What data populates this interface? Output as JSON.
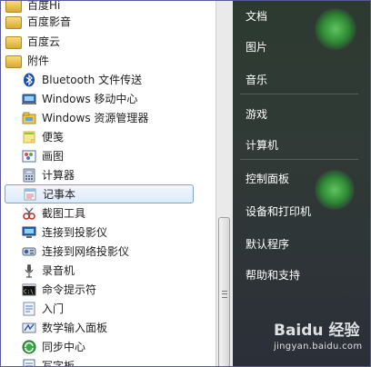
{
  "programs": {
    "items": [
      {
        "label": "百度Hi",
        "type": "folder",
        "icon": "folder-icon"
      },
      {
        "label": "百度影音",
        "type": "folder",
        "icon": "folder-icon"
      },
      {
        "label": "百度云",
        "type": "folder",
        "icon": "folder-icon"
      },
      {
        "label": "附件",
        "type": "folder",
        "icon": "folder-icon"
      },
      {
        "label": "Bluetooth 文件传送",
        "type": "item",
        "icon": "bluetooth-icon"
      },
      {
        "label": "Windows 移动中心",
        "type": "item",
        "icon": "mobility-center-icon"
      },
      {
        "label": "Windows 资源管理器",
        "type": "item",
        "icon": "explorer-icon"
      },
      {
        "label": "便笺",
        "type": "item",
        "icon": "sticky-notes-icon"
      },
      {
        "label": "画图",
        "type": "item",
        "icon": "paint-icon"
      },
      {
        "label": "计算器",
        "type": "item",
        "icon": "calculator-icon"
      },
      {
        "label": "记事本",
        "type": "item",
        "icon": "notepad-icon",
        "selected": true
      },
      {
        "label": "截图工具",
        "type": "item",
        "icon": "snipping-tool-icon"
      },
      {
        "label": "连接到投影仪",
        "type": "item",
        "icon": "projector-icon"
      },
      {
        "label": "连接到网络投影仪",
        "type": "item",
        "icon": "network-projector-icon"
      },
      {
        "label": "录音机",
        "type": "item",
        "icon": "microphone-icon"
      },
      {
        "label": "命令提示符",
        "type": "item",
        "icon": "cmd-icon"
      },
      {
        "label": "入门",
        "type": "item",
        "icon": "getting-started-icon"
      },
      {
        "label": "数学输入面板",
        "type": "item",
        "icon": "math-input-icon"
      },
      {
        "label": "同步中心",
        "type": "item",
        "icon": "sync-center-icon"
      },
      {
        "label": "写字板",
        "type": "item",
        "icon": "wordpad-icon"
      }
    ]
  },
  "right_menu": {
    "items": [
      "文档",
      "图片",
      "音乐",
      "游戏",
      "计算机",
      "控制面板",
      "设备和打印机",
      "默认程序",
      "帮助和支持"
    ]
  },
  "watermark": {
    "title": "Baidu 经验",
    "url": "jingyan.baidu.com"
  },
  "colors": {
    "accent_selection": "#dcebfc",
    "right_panel": "#2c3a30",
    "orb": "#3fae45"
  }
}
